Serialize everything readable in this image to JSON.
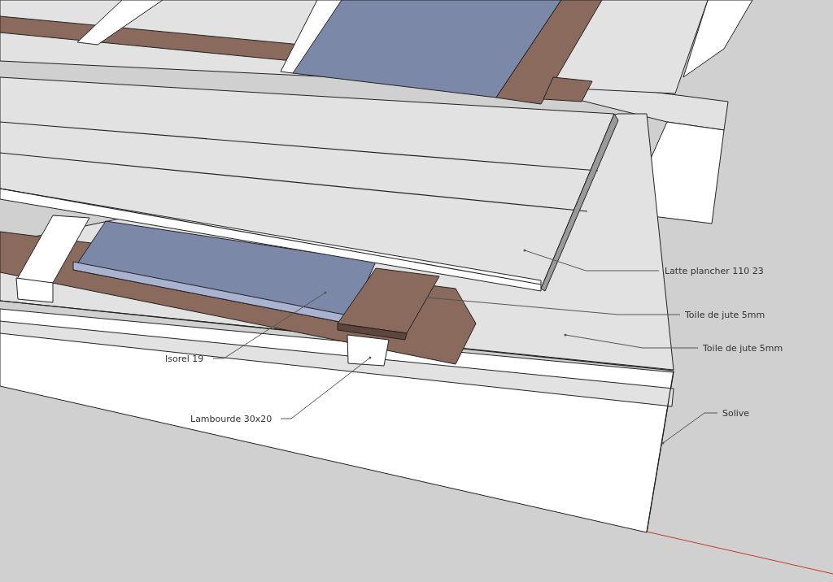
{
  "viewport": {
    "labels": [
      {
        "text": "Latte plancher 110 23"
      },
      {
        "text": "Toile de jute 5mm"
      },
      {
        "text": "Toile de jute 5mm"
      },
      {
        "text": "Solive"
      },
      {
        "text": "Isorel 19"
      },
      {
        "text": "Lambourde 30x20"
      }
    ]
  }
}
